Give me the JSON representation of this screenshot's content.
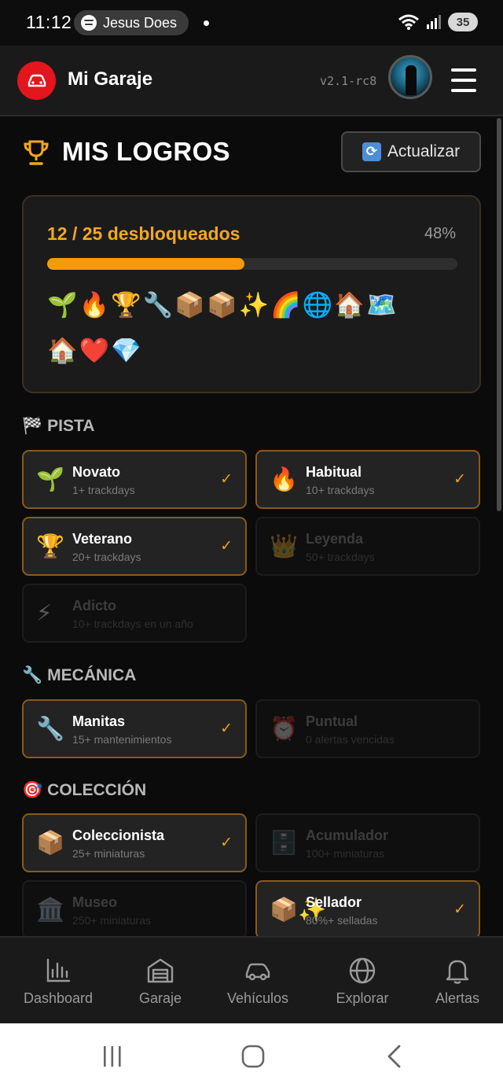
{
  "status_bar": {
    "time": "11:12",
    "media_title": "Jesus Does",
    "battery": "35"
  },
  "header": {
    "app_title": "Mi Garaje",
    "version": "v2.1-rc8"
  },
  "page": {
    "title": "MIS LOGROS",
    "refresh_label": "Actualizar"
  },
  "summary": {
    "unlocked_text": "12 / 25 desbloqueados",
    "percent_text": "48%",
    "progress": 0.48,
    "badges_row1": "🌱🔥🏆🔧📦📦✨🌈🌐🏠🗺️",
    "badges_row2": "🏠❤️💎"
  },
  "sections": {
    "pista": {
      "emoji": "🏁",
      "title": "PISTA",
      "cards": [
        {
          "icon": "🌱",
          "name": "Novato",
          "desc": "1+ trackdays",
          "unlocked": true
        },
        {
          "icon": "🔥",
          "name": "Habitual",
          "desc": "10+ trackdays",
          "unlocked": true
        },
        {
          "icon": "🏆",
          "name": "Veterano",
          "desc": "20+ trackdays",
          "unlocked": true
        },
        {
          "icon": "👑",
          "name": "Leyenda",
          "desc": "50+ trackdays",
          "unlocked": false
        },
        {
          "icon": "⚡",
          "name": "Adicto",
          "desc": "10+ trackdays en un año",
          "unlocked": false
        }
      ]
    },
    "mecanica": {
      "emoji": "🔧",
      "title": "MECÁNICA",
      "cards": [
        {
          "icon": "🔧",
          "name": "Manitas",
          "desc": "15+ mantenimientos",
          "unlocked": true
        },
        {
          "icon": "⏰",
          "name": "Puntual",
          "desc": "0 alertas vencidas",
          "unlocked": false
        }
      ]
    },
    "coleccion": {
      "emoji": "🎯",
      "title": "COLECCIÓN",
      "cards": [
        {
          "icon": "📦",
          "name": "Coleccionista",
          "desc": "25+ miniaturas",
          "unlocked": true
        },
        {
          "icon": "🗄️",
          "name": "Acumulador",
          "desc": "100+ miniaturas",
          "unlocked": false
        },
        {
          "icon": "🏛️",
          "name": "Museo",
          "desc": "250+ miniaturas",
          "unlocked": false
        },
        {
          "icon": "📦✨",
          "name": "Sellador",
          "desc": "80%+ selladas",
          "unlocked": true
        }
      ]
    }
  },
  "check_mark": "✓",
  "bottom_nav": [
    {
      "label": "Dashboard",
      "icon": "chart-icon"
    },
    {
      "label": "Garaje",
      "icon": "garage-icon"
    },
    {
      "label": "Vehículos",
      "icon": "car-icon"
    },
    {
      "label": "Explorar",
      "icon": "globe-icon"
    },
    {
      "label": "Alertas",
      "icon": "bell-icon"
    }
  ],
  "colors": {
    "accent": "#f59a0b",
    "brand_red": "#e3151d",
    "background": "#0b0b0b"
  }
}
